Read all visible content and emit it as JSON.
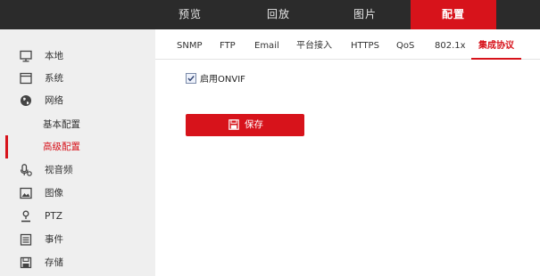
{
  "topnav": {
    "items": [
      {
        "label": "预览"
      },
      {
        "label": "回放"
      },
      {
        "label": "图片"
      },
      {
        "label": "配置"
      }
    ]
  },
  "sidebar": {
    "items": [
      {
        "label": "本地",
        "icon": "monitor-icon"
      },
      {
        "label": "系统",
        "icon": "window-icon"
      },
      {
        "label": "网络",
        "icon": "globe-icon"
      },
      {
        "label": "基本配置"
      },
      {
        "label": "高级配置"
      },
      {
        "label": "视音频",
        "icon": "microphone-icon"
      },
      {
        "label": "图像",
        "icon": "image-icon"
      },
      {
        "label": "PTZ",
        "icon": "person-icon"
      },
      {
        "label": "事件",
        "icon": "calendar-icon"
      },
      {
        "label": "存储",
        "icon": "disk-icon"
      }
    ]
  },
  "tabs": [
    {
      "label": "SNMP"
    },
    {
      "label": "FTP"
    },
    {
      "label": "Email"
    },
    {
      "label": "平台接入"
    },
    {
      "label": "HTTPS"
    },
    {
      "label": "QoS"
    },
    {
      "label": "802.1x"
    },
    {
      "label": "集成协议"
    }
  ],
  "settings": {
    "onvif_label": "启用ONVIF",
    "onvif_checked": true
  },
  "actions": {
    "save_label": "保存"
  },
  "colors": {
    "accent": "#d7131b",
    "topbar": "#2b2b2b",
    "sidebar": "#efefef"
  }
}
